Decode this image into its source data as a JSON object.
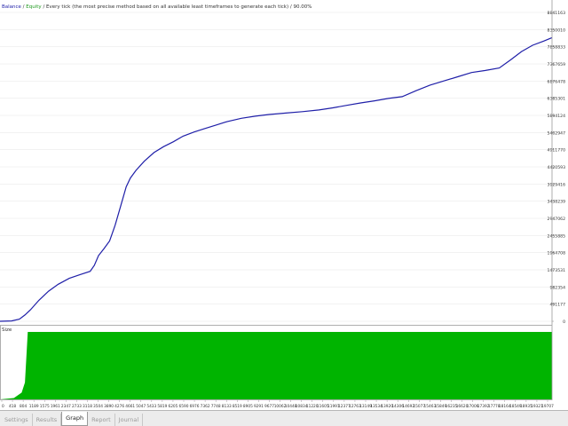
{
  "legend": {
    "balance": "Balance",
    "separator1": " / ",
    "equity": "Equity",
    "description": " / Every tick (the most precise method based on all available least timeframes to generate each tick) / 90.00%"
  },
  "size_label": "Size",
  "tabs": [
    {
      "label": "Settings",
      "active": false
    },
    {
      "label": "Results",
      "active": false
    },
    {
      "label": "Graph",
      "active": true
    },
    {
      "label": "Report",
      "active": false
    },
    {
      "label": "Journal",
      "active": false
    }
  ],
  "colors": {
    "balance": "#1f1fa8",
    "equity": "#1f9a1f",
    "size_fill": "#00b400",
    "grid": "#e6e6e6",
    "axis": "#9a9a9a",
    "text": "#333333"
  },
  "chart_data": {
    "type": "line",
    "y_ticks": [
      "8841163",
      "8350010",
      "7858833",
      "7367659",
      "6876478",
      "6385301",
      "5894124",
      "5402947",
      "4911770",
      "4420593",
      "3929416",
      "3438239",
      "2947062",
      "2455885",
      "1964708",
      "1473531",
      "982354",
      "491177",
      "0"
    ],
    "x_ticks": [
      "0",
      "418",
      "804",
      "1189",
      "1575",
      "1961",
      "2347",
      "2733",
      "3118",
      "3504",
      "3890",
      "4276",
      "4661",
      "5047",
      "5433",
      "5819",
      "6205",
      "6590",
      "6976",
      "7362",
      "7748",
      "8133",
      "8519",
      "8905",
      "9291",
      "9677",
      "10062",
      "10448",
      "10834",
      "11220",
      "11605",
      "11991",
      "12377",
      "12763",
      "13149",
      "13534",
      "13920",
      "14306",
      "14692",
      "15077",
      "15463",
      "15849",
      "16235",
      "16620",
      "17006",
      "17392",
      "17778",
      "18164",
      "18549",
      "18935",
      "19321",
      "19707"
    ],
    "ylim": [
      0,
      8841163
    ],
    "xlim": [
      0,
      19900
    ],
    "series": [
      {
        "name": "Balance",
        "points": [
          [
            0,
            0
          ],
          [
            418,
            10000
          ],
          [
            700,
            60000
          ],
          [
            900,
            180000
          ],
          [
            1100,
            330000
          ],
          [
            1400,
            600000
          ],
          [
            1750,
            860000
          ],
          [
            2100,
            1060000
          ],
          [
            2500,
            1230000
          ],
          [
            2900,
            1340000
          ],
          [
            3250,
            1430000
          ],
          [
            3400,
            1600000
          ],
          [
            3550,
            1880000
          ],
          [
            3750,
            2080000
          ],
          [
            3950,
            2300000
          ],
          [
            4150,
            2750000
          ],
          [
            4350,
            3300000
          ],
          [
            4550,
            3850000
          ],
          [
            4700,
            4100000
          ],
          [
            4900,
            4320000
          ],
          [
            5200,
            4580000
          ],
          [
            5550,
            4830000
          ],
          [
            5900,
            5000000
          ],
          [
            6250,
            5140000
          ],
          [
            6600,
            5300000
          ],
          [
            7000,
            5420000
          ],
          [
            7400,
            5520000
          ],
          [
            7800,
            5620000
          ],
          [
            8200,
            5720000
          ],
          [
            8700,
            5810000
          ],
          [
            9200,
            5870000
          ],
          [
            9700,
            5920000
          ],
          [
            10300,
            5960000
          ],
          [
            10900,
            6000000
          ],
          [
            11500,
            6050000
          ],
          [
            12000,
            6110000
          ],
          [
            12500,
            6180000
          ],
          [
            13000,
            6250000
          ],
          [
            13500,
            6310000
          ],
          [
            14000,
            6380000
          ],
          [
            14500,
            6430000
          ],
          [
            15000,
            6600000
          ],
          [
            15500,
            6760000
          ],
          [
            16000,
            6880000
          ],
          [
            16500,
            7000000
          ],
          [
            17000,
            7120000
          ],
          [
            17500,
            7180000
          ],
          [
            18000,
            7250000
          ],
          [
            18400,
            7480000
          ],
          [
            18800,
            7720000
          ],
          [
            19200,
            7900000
          ],
          [
            19600,
            8020000
          ],
          [
            19900,
            8120000
          ]
        ]
      }
    ],
    "size_series": {
      "name": "Size",
      "x_start": 1000,
      "x_end": 19900,
      "ramp": [
        [
          0,
          0
        ],
        [
          500,
          0.02
        ],
        [
          780,
          0.1
        ],
        [
          900,
          0.25
        ],
        [
          1000,
          1.0
        ]
      ]
    }
  }
}
